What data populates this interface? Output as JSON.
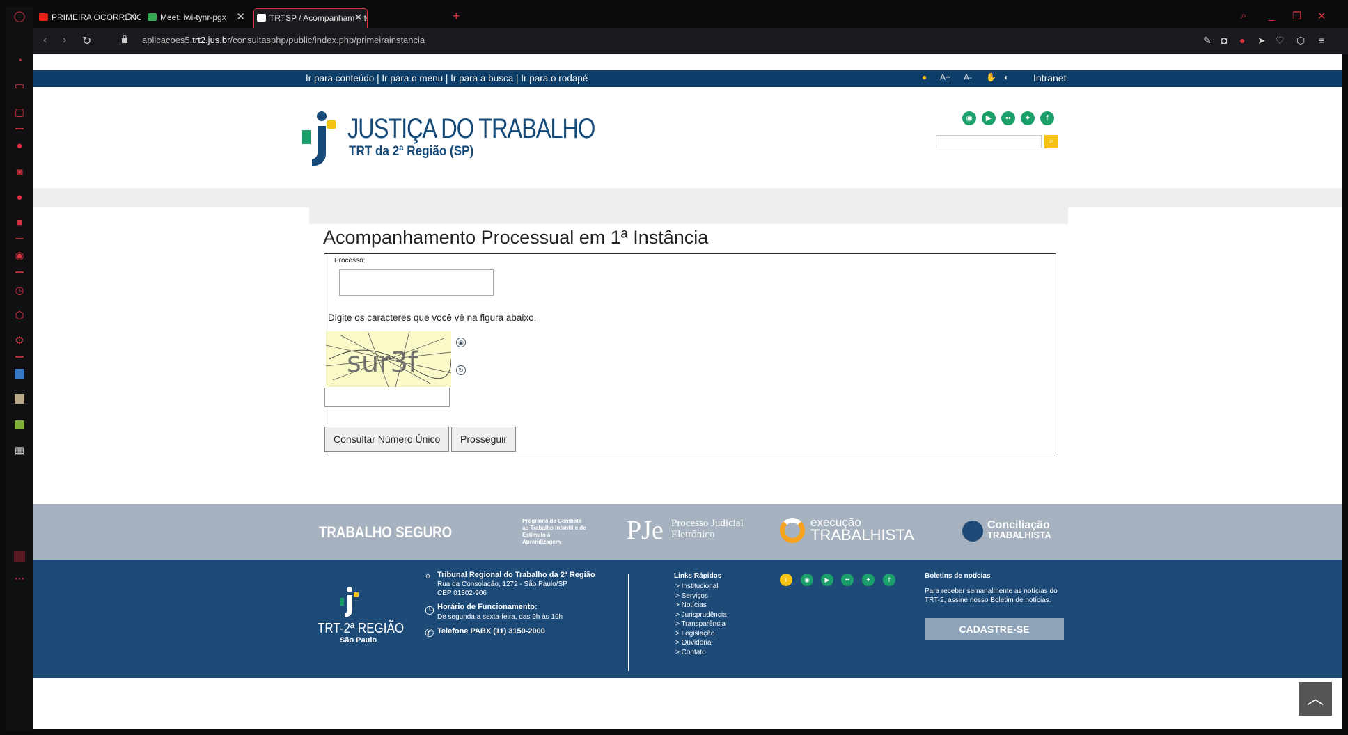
{
  "browser": {
    "tabs": [
      {
        "label": "PRIMEIRA OCORRÊNCIA M",
        "favicon_color": "#e62117"
      },
      {
        "label": "Meet: iwi-tynr-pgx",
        "favicon_color": "#34a853"
      },
      {
        "label": "TRTSP / Acompanhamento",
        "favicon_color": "#ffffff"
      }
    ],
    "url_prefix": "aplicacoes5.",
    "url_domain": "trt2.jus.br",
    "url_path": "/consultasphp/public/index.php/primeirainstancia"
  },
  "topbar": {
    "links": [
      "Ir para conteúdo",
      "Ir para o menu",
      "Ir para a busca",
      "Ir para o rodapé"
    ],
    "separator": " | ",
    "accessibility": [
      "A+",
      "A-"
    ],
    "intranet": "Intranet"
  },
  "header": {
    "title": "JUSTIÇA DO TRABALHO",
    "subtitle": "TRT da 2ª Região (SP)",
    "social_icons": [
      "rss-icon",
      "youtube-icon",
      "flickr-icon",
      "twitter-icon",
      "facebook-icon"
    ],
    "colors": {
      "navy": "#0d3e69",
      "green": "#1ba06b",
      "yellow": "#f6c211"
    }
  },
  "main": {
    "title": "Acompanhamento Processual em 1ª Instância",
    "processo_label": "Processo:",
    "captcha_instruction": "Digite os caracteres que você vê na figura abaixo.",
    "captcha_text": "sur3f",
    "btn_consultar": "Consultar Número Único",
    "btn_prosseguir": "Prosseguir"
  },
  "partners": {
    "trabalho_seguro": "TRABALHO SEGURO",
    "programa": "Programa de Combate ao Trabalho Infantil e de Estímulo à Aprendizagem",
    "pje_mark": "PJe",
    "pje_text1": "Processo Judicial",
    "pje_text2": "Eletrônico",
    "execucao1": "execução",
    "execucao2": "TRABALHISTA",
    "conciliacao1": "Conciliação",
    "conciliacao2": "TRABALHISTA"
  },
  "footer": {
    "logo1": "TRT-2ª REGIÃO",
    "logo2": "São Paulo",
    "tribunal": "Tribunal Regional do Trabalho da 2ª Região",
    "address1": "Rua da Consolação, 1272 - São Paulo/SP",
    "address2": "CEP 01302-906",
    "horario_title": "Horário de Funcionamento:",
    "horario": "De segunda a sexta-feira, das 9h às 19h",
    "telefone": "Telefone PABX (11) 3150-2000",
    "links_title": "Links Rápidos",
    "links": [
      "> Institucional",
      "> Serviços",
      "> Notícias",
      "> Jurisprudência",
      "> Transparência",
      "> Legislação",
      "> Ouvidoria",
      "> Contato"
    ],
    "boletim_title": "Boletins de notícias",
    "boletim1": "Para receber semanalmente as notícias do",
    "boletim2": "TRT-2, assine nosso Boletim de notícias.",
    "cadastre": "CADASTRE-SE"
  }
}
